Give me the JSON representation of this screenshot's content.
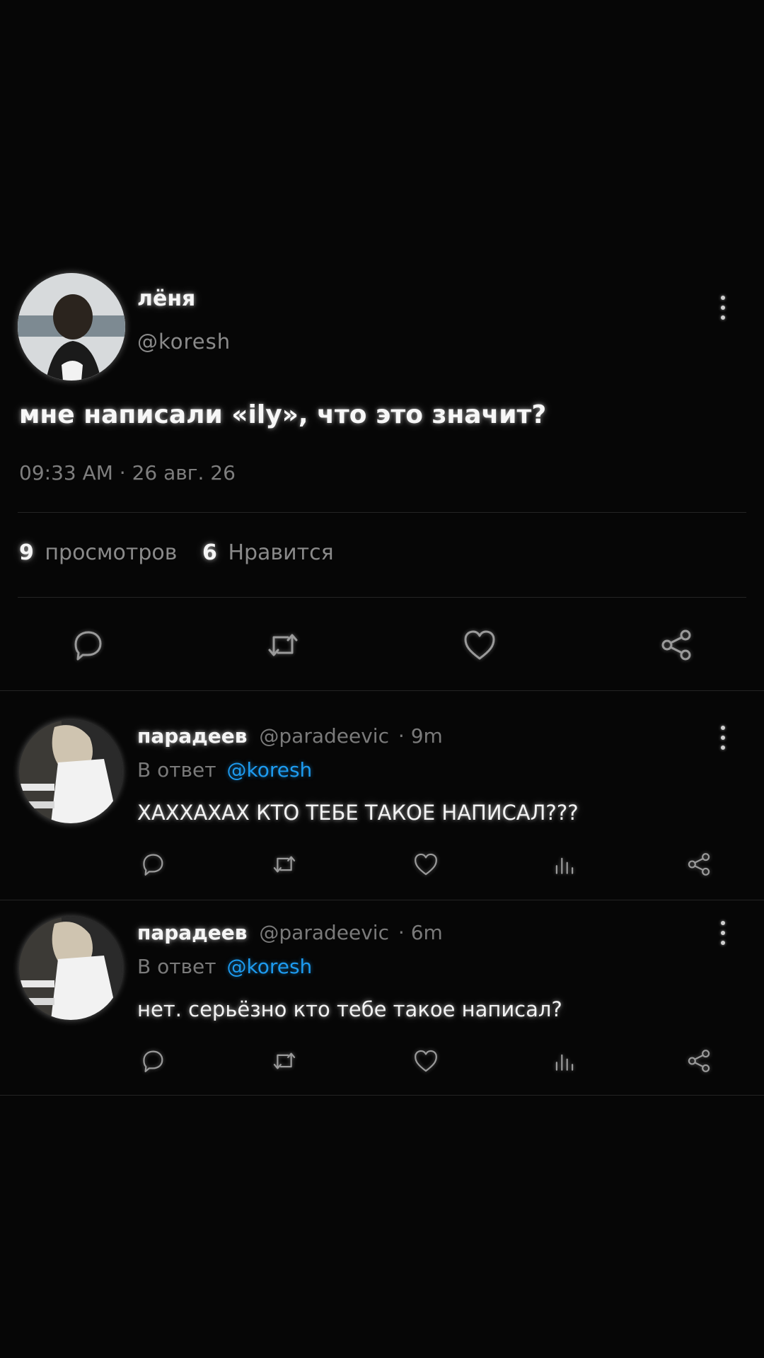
{
  "post": {
    "author_name": "лёня",
    "author_handle": "@koresh",
    "text": "мне написали «ily», что это значит?",
    "timestamp": "09:33 AM · 26 авг. 26",
    "views_count": "9",
    "views_label": "просмотров",
    "likes_count": "6",
    "likes_label": "Нравится",
    "actions": [
      "reply-icon",
      "retweet-icon",
      "heart-icon",
      "share-icon"
    ]
  },
  "replies": [
    {
      "author_name": "парадеев",
      "author_handle": "@paradeevic",
      "time": "· 9m",
      "reply_prefix": "В ответ",
      "reply_to": "@koresh",
      "text": "ХАХХАХАХ КТО ТЕБЕ ТАКОЕ НАПИСАЛ???",
      "actions": [
        "reply-icon",
        "retweet-icon",
        "heart-icon",
        "stats-icon",
        "share-icon"
      ]
    },
    {
      "author_name": "парадеев",
      "author_handle": "@paradeevic",
      "time": "· 6m",
      "reply_prefix": "В ответ",
      "reply_to": "@koresh",
      "text": "нет. серьёзно кто тебе такое  написал?",
      "actions": [
        "reply-icon",
        "retweet-icon",
        "heart-icon",
        "stats-icon",
        "share-icon"
      ]
    }
  ],
  "colors": {
    "background": "#060606",
    "text": "#e9e9e9",
    "muted": "#8a8a8a",
    "mention": "#1d9bf0",
    "divider": "#242424"
  }
}
